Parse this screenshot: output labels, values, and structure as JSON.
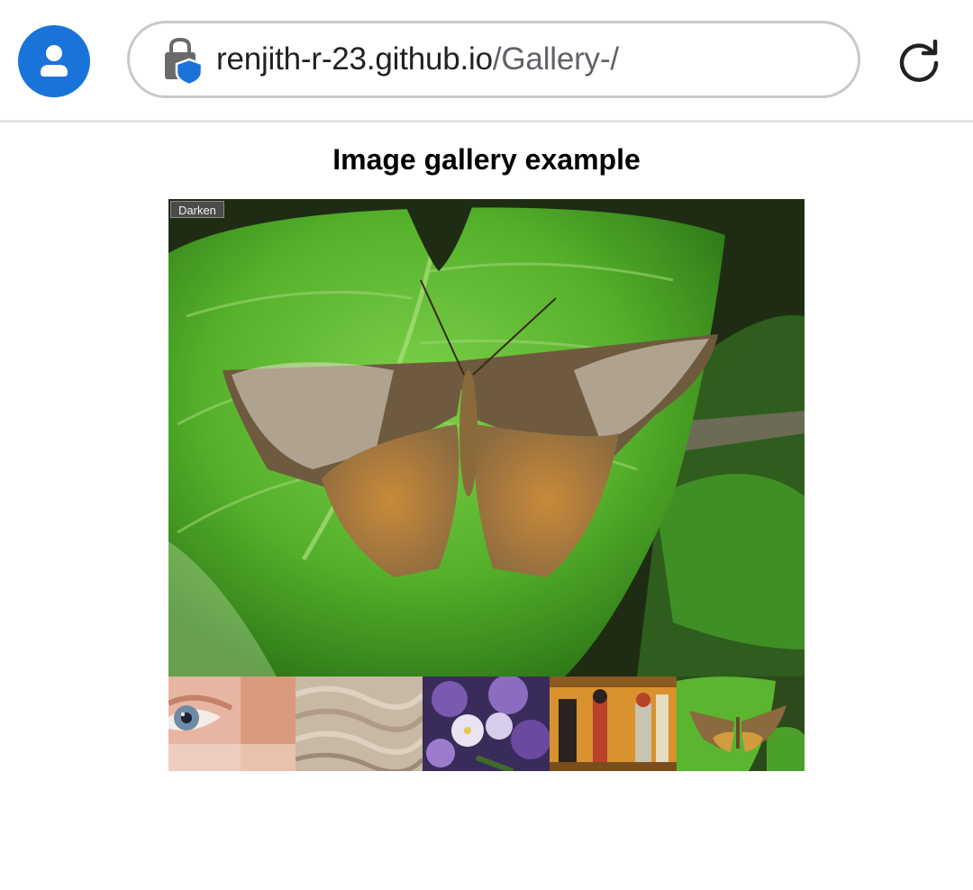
{
  "browser": {
    "url_host": "renjith-r-23.github.io",
    "url_path": "/Gallery-/",
    "icons": [
      "account-icon",
      "lock-shield-icon",
      "reload-icon"
    ],
    "accent_color": "#1a73d9"
  },
  "page": {
    "title": "Image gallery example"
  },
  "gallery": {
    "darken_label": "Darken",
    "main_image": "butterfly",
    "thumbnails": [
      "eye",
      "rock-texture",
      "purple-flowers",
      "egyptian-painting",
      "butterfly"
    ]
  }
}
